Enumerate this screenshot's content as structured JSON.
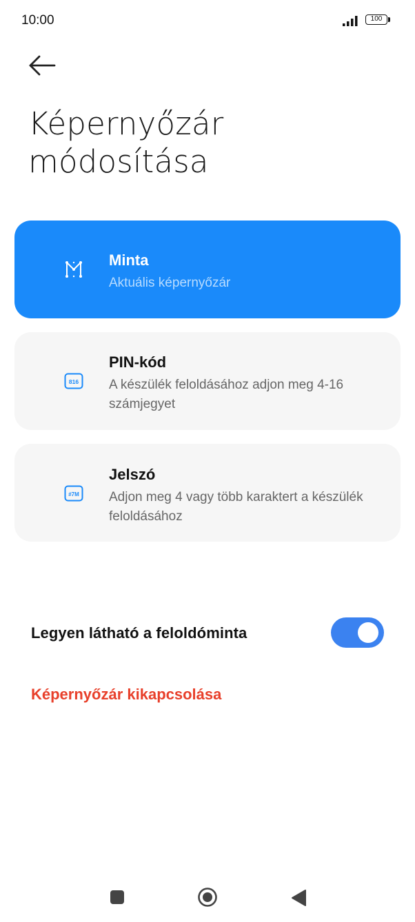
{
  "status_bar": {
    "time": "10:00",
    "battery": "100"
  },
  "header": {
    "back_icon": "arrow-left-icon",
    "title_line1": "Képernyőzár",
    "title_line2": "módosítása"
  },
  "options": [
    {
      "id": "minta",
      "title": "Minta",
      "description": "Aktuális képernyőzár",
      "icon": "pattern-icon",
      "selected": true
    },
    {
      "id": "pin",
      "title": "PIN-kód",
      "description": "A készülék feloldásához adjon meg 4-16 számjegyet",
      "icon": "pin-icon",
      "icon_text": "816",
      "selected": false
    },
    {
      "id": "jelszo",
      "title": "Jelszó",
      "description": "Adjon meg 4 vagy több karaktert a készülék feloldásához",
      "icon": "password-icon",
      "icon_text": "#7M",
      "selected": false
    }
  ],
  "settings": {
    "show_pattern_label": "Legyen látható a feloldóminta",
    "show_pattern_enabled": true,
    "disable_lock_label": "Képernyőzár kikapcsolása"
  },
  "colors": {
    "accent": "#1a8afa",
    "toggle_on": "#3b82f0",
    "danger": "#e8402b",
    "card_bg": "#f6f6f6"
  },
  "nav_bar": {
    "recents_icon": "square-recents-icon",
    "home_icon": "circle-home-icon",
    "back_icon": "triangle-back-icon"
  }
}
